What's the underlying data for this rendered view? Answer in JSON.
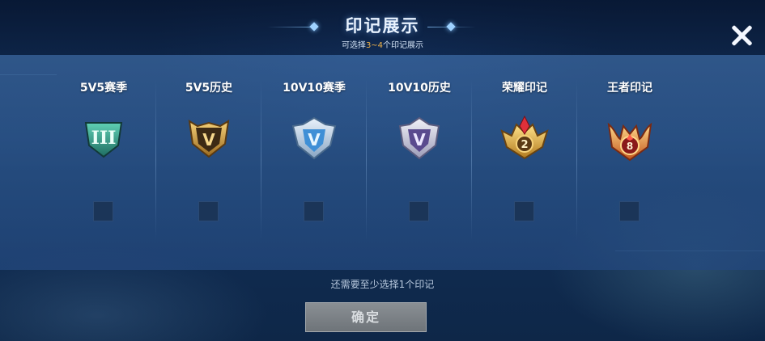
{
  "header": {
    "title": "印记展示",
    "subtitle_prefix": "可选择",
    "subtitle_highlight": "3~4",
    "subtitle_suffix": "个印记展示"
  },
  "marks": [
    {
      "label": "5V5赛季",
      "icon": "bronze-iii-shield-icon"
    },
    {
      "label": "5V5历史",
      "icon": "gold-v-shield-icon"
    },
    {
      "label": "10V10赛季",
      "icon": "silver-blue-v-shield-icon"
    },
    {
      "label": "10V10历史",
      "icon": "silver-purple-v-shield-icon"
    },
    {
      "label": "荣耀印记",
      "icon": "glory-crown-2-icon",
      "number": "2"
    },
    {
      "label": "王者印记",
      "icon": "king-emblem-8-icon",
      "number": "8"
    }
  ],
  "footer": {
    "hint": "还需要至少选择1个印记",
    "confirm_label": "确定"
  },
  "colors": {
    "highlight": "#f3b54a",
    "panel": "#3a669e",
    "checkbox": "#1b3558"
  }
}
